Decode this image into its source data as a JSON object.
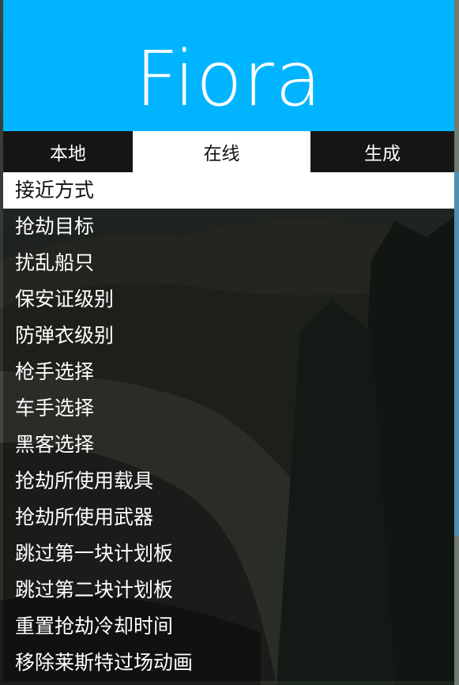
{
  "header": {
    "title": "Fiora",
    "color": "#00b4ff"
  },
  "tabs": [
    {
      "label": "本地",
      "active": false
    },
    {
      "label": "在线",
      "active": true
    },
    {
      "label": "生成",
      "active": false
    }
  ],
  "menu": {
    "selected_index": 0,
    "items": [
      {
        "label": "接近方式"
      },
      {
        "label": "抢劫目标"
      },
      {
        "label": "扰乱船只"
      },
      {
        "label": "保安证级别"
      },
      {
        "label": "防弹衣级别"
      },
      {
        "label": "枪手选择"
      },
      {
        "label": "车手选择"
      },
      {
        "label": "黑客选择"
      },
      {
        "label": "抢劫所使用载具"
      },
      {
        "label": "抢劫所使用武器"
      },
      {
        "label": "跳过第一块计划板"
      },
      {
        "label": "跳过第二块计划板"
      },
      {
        "label": "重置抢劫冷却时间"
      },
      {
        "label": "移除莱斯特过场动画"
      }
    ]
  }
}
